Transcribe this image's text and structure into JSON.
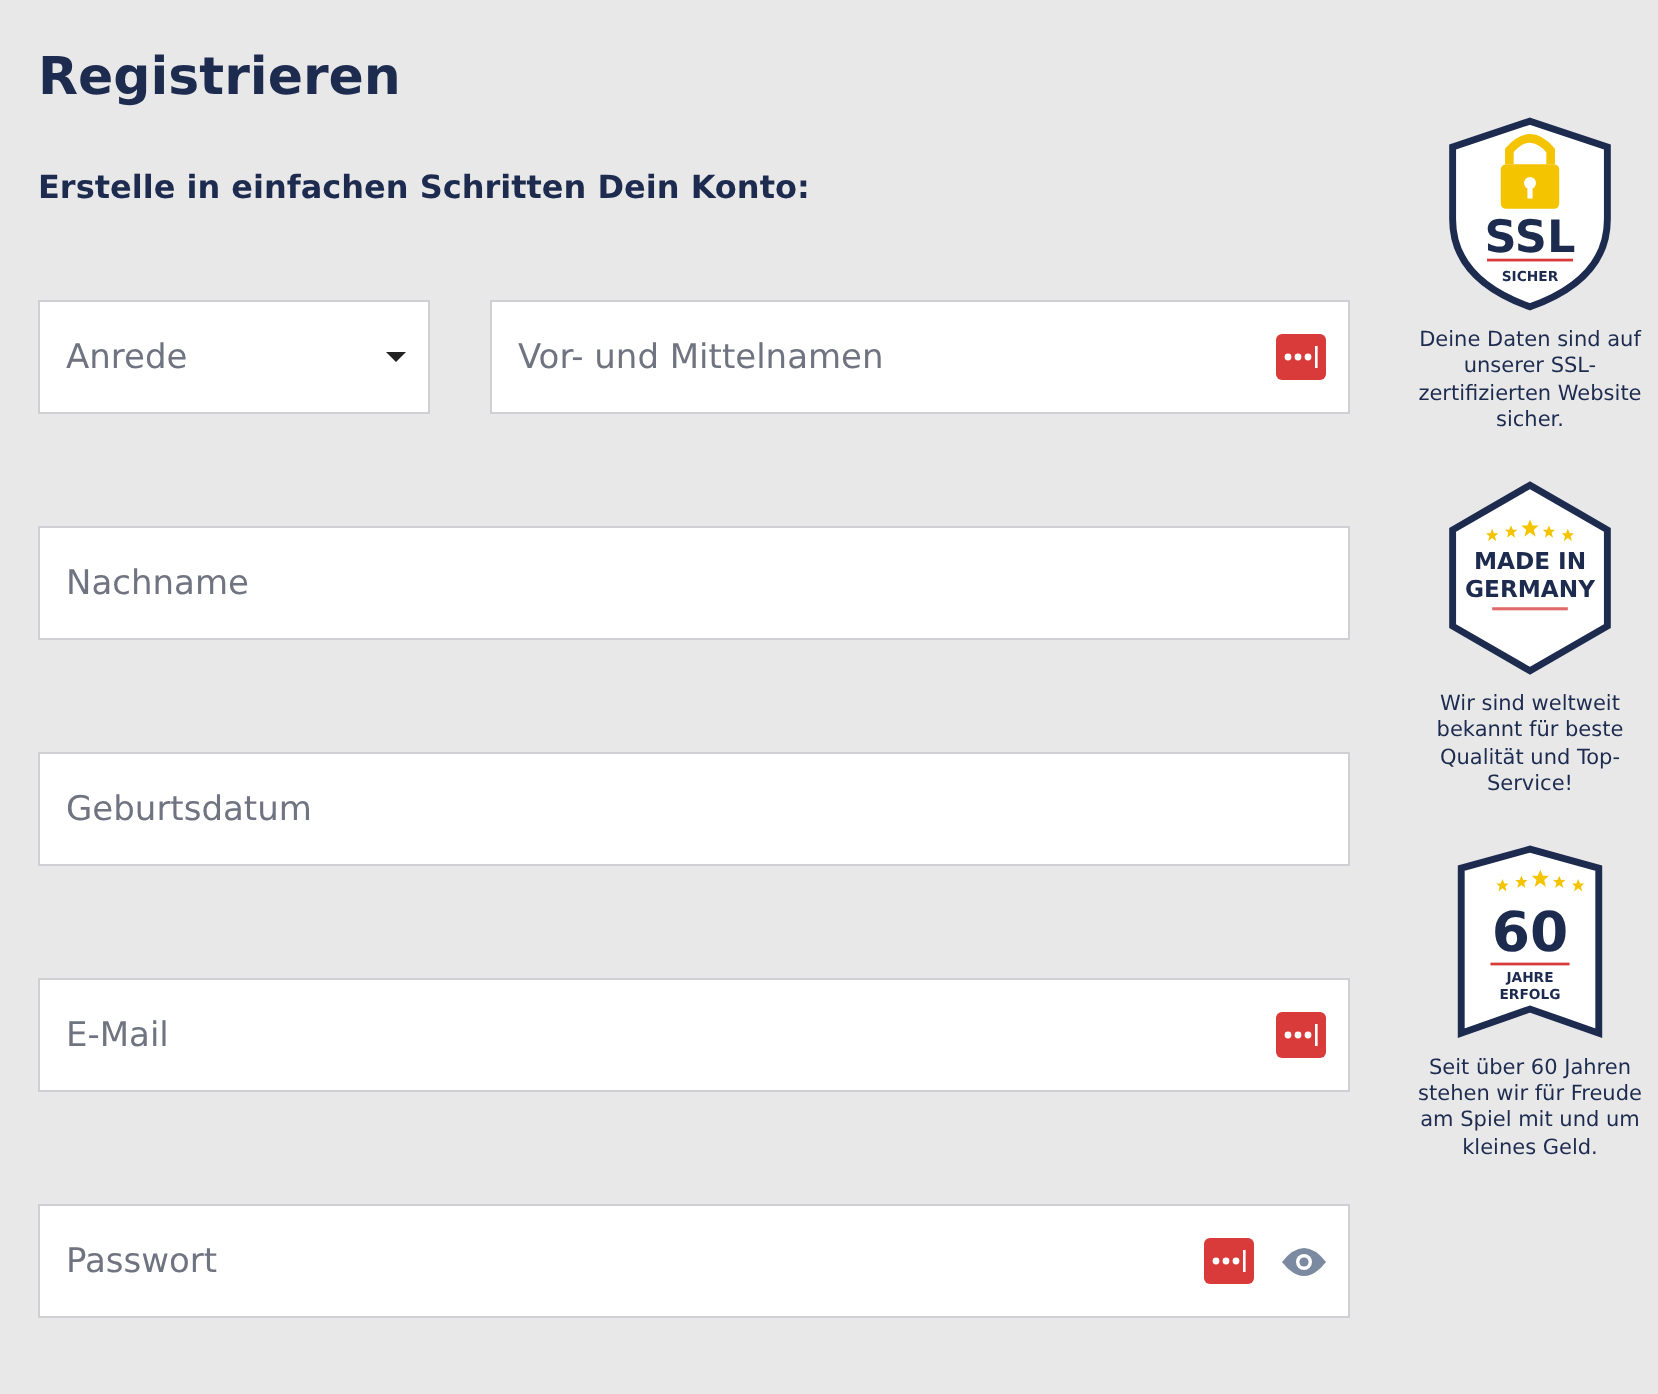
{
  "title": "Registrieren",
  "subtitle": "Erstelle in einfachen Schritten Dein Konto:",
  "form_rows": [
    [
      {
        "kind": "select",
        "placeholder": "Anrede",
        "password_manager": false,
        "reveal": false
      },
      {
        "kind": "text",
        "placeholder": "Vor- und Mittelnamen",
        "password_manager": true,
        "reveal": false
      }
    ],
    [
      {
        "kind": "text",
        "placeholder": "Nachname",
        "password_manager": false,
        "reveal": false
      }
    ],
    [
      {
        "kind": "text",
        "placeholder": "Geburtsdatum",
        "password_manager": false,
        "reveal": false
      }
    ],
    [
      {
        "kind": "text",
        "placeholder": "E-Mail",
        "password_manager": true,
        "reveal": false
      }
    ],
    [
      {
        "kind": "password",
        "placeholder": "Passwort",
        "password_manager": true,
        "reveal": true
      }
    ]
  ],
  "badges": [
    {
      "kind": "ssl",
      "lines": [
        "SSL",
        "SICHER"
      ],
      "caption": "Deine Daten sind auf unserer SSL-zertifizierten Website sicher."
    },
    {
      "kind": "made",
      "lines": [
        "MADE IN",
        "GERMANY"
      ],
      "caption": "Wir sind weltweit bekannt für beste Qualität und Top-Service!"
    },
    {
      "kind": "years",
      "lines": [
        "60",
        "JAHRE",
        "ERFOLG"
      ],
      "caption": "Seit über 60 Jahren stehen wir für Freude am Spiel mit und um kleines Geld."
    }
  ]
}
